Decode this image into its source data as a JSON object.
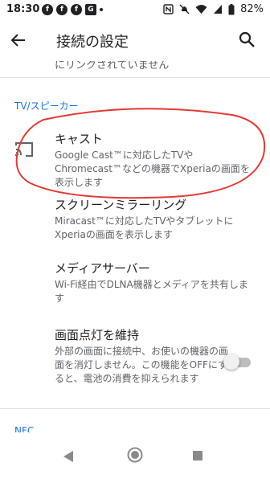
{
  "status_bar": {
    "time": "18:30",
    "left_icons": [
      "facebook-icon",
      "facebook-icon",
      "facebook-icon",
      "app-icon"
    ],
    "battery": "82%",
    "right_icons": [
      "nfc-icon",
      "mute-icon",
      "wifi-icon",
      "signal-icon",
      "battery-icon"
    ]
  },
  "app_bar": {
    "title": "接続の設定",
    "back_icon": "arrow-back-icon",
    "search_icon": "search-icon"
  },
  "content": {
    "partial_row_text": "にリンクされていません",
    "sections": [
      {
        "header": "TV/スピーカー",
        "items": [
          {
            "title": "キャスト",
            "summary": "Google Cast™に対応したTVやChromecast™などの機器でXperiaの画面を表示します",
            "icon": "cast-icon"
          },
          {
            "title": "スクリーンミラーリング",
            "summary": "Miracast™に対応したTVやタブレットにXperiaの画面を表示します"
          },
          {
            "title": "メディアサーバー",
            "summary": "Wi-Fi経由でDLNA機器とメディアを共有します"
          },
          {
            "title": "画面点灯を維持",
            "summary": "外部の画面に接続中、お使いの機器の画面を消灯しません。この機能をOFFにすると、電池の消費を抑えられます",
            "toggle_on": false
          }
        ]
      },
      {
        "header": "NFC",
        "items": []
      }
    ]
  },
  "colors": {
    "accent": "#1a73e8",
    "annotation": "#e53935",
    "text_primary": "#202124",
    "text_secondary": "#5f6368"
  },
  "nav_bar": {
    "icons": [
      "nav-back-icon",
      "nav-home-icon",
      "nav-recents-icon"
    ]
  }
}
